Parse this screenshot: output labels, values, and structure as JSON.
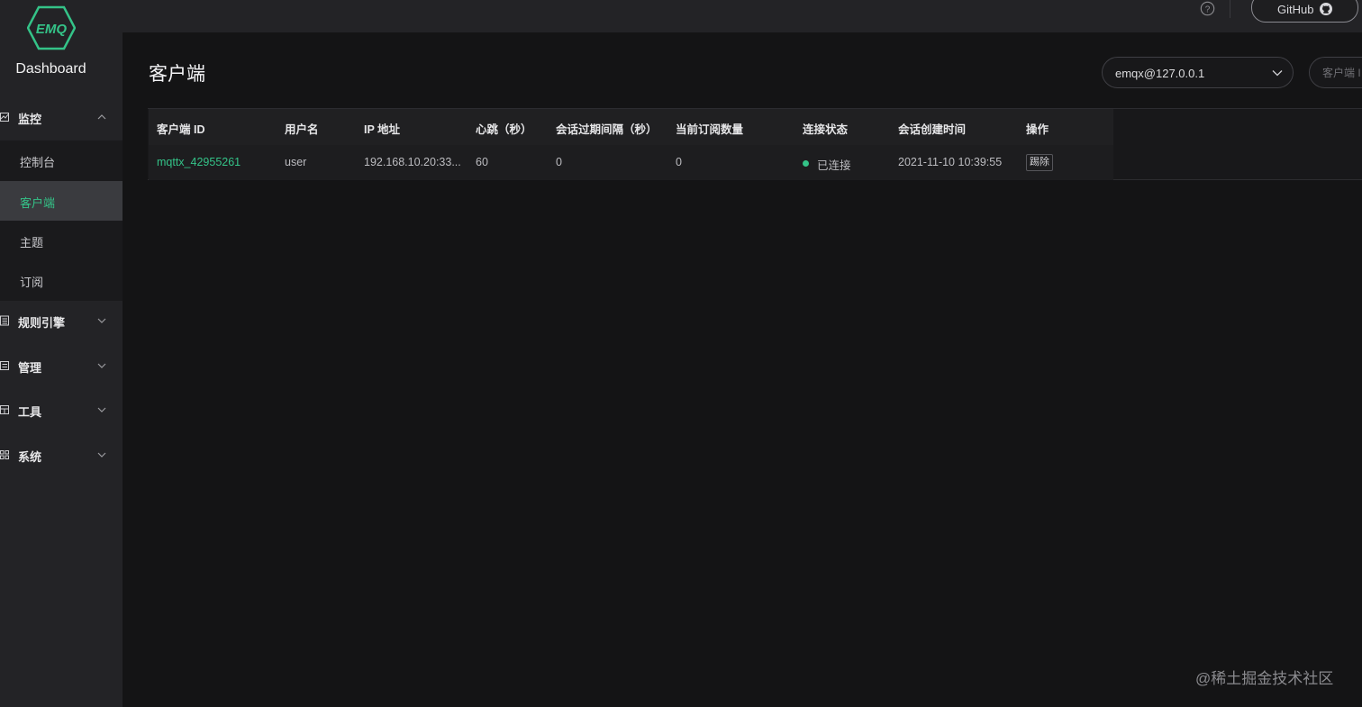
{
  "app": {
    "logo_text": "EMQ",
    "name": "Dashboard"
  },
  "topbar": {
    "github_label": "GitHub"
  },
  "sidebar": {
    "groups": [
      {
        "label": "监控",
        "icon": "chart-icon",
        "expanded": true,
        "items": [
          {
            "label": "控制台",
            "active": false
          },
          {
            "label": "客户端",
            "active": true
          },
          {
            "label": "主题",
            "active": false
          },
          {
            "label": "订阅",
            "active": false
          }
        ]
      },
      {
        "label": "规则引擎",
        "icon": "list-icon",
        "expanded": false
      },
      {
        "label": "管理",
        "icon": "manage-icon",
        "expanded": false
      },
      {
        "label": "工具",
        "icon": "tool-icon",
        "expanded": false
      },
      {
        "label": "系统",
        "icon": "grid-icon",
        "expanded": false
      }
    ]
  },
  "main": {
    "title": "客户端",
    "node_select": "emqx@127.0.0.1",
    "search_placeholder": "客户端 I",
    "table": {
      "columns": [
        "客户端 ID",
        "用户名",
        "IP 地址",
        "心跳（秒）",
        "会话过期间隔（秒）",
        "当前订阅数量",
        "连接状态",
        "会话创建时间",
        "操作"
      ],
      "rows": [
        {
          "client_id": "mqttx_42955261",
          "username": "user",
          "ip": "192.168.10.20:33...",
          "keepalive": "60",
          "expiry": "0",
          "subscriptions": "0",
          "status": "已连接",
          "created_at": "2021-11-10 10:39:55",
          "action": "踢除"
        }
      ]
    }
  },
  "watermark": "@稀土掘金技术社区",
  "colors": {
    "accent": "#34c388",
    "sidebar_bg": "#232326",
    "page_bg": "#141415"
  }
}
